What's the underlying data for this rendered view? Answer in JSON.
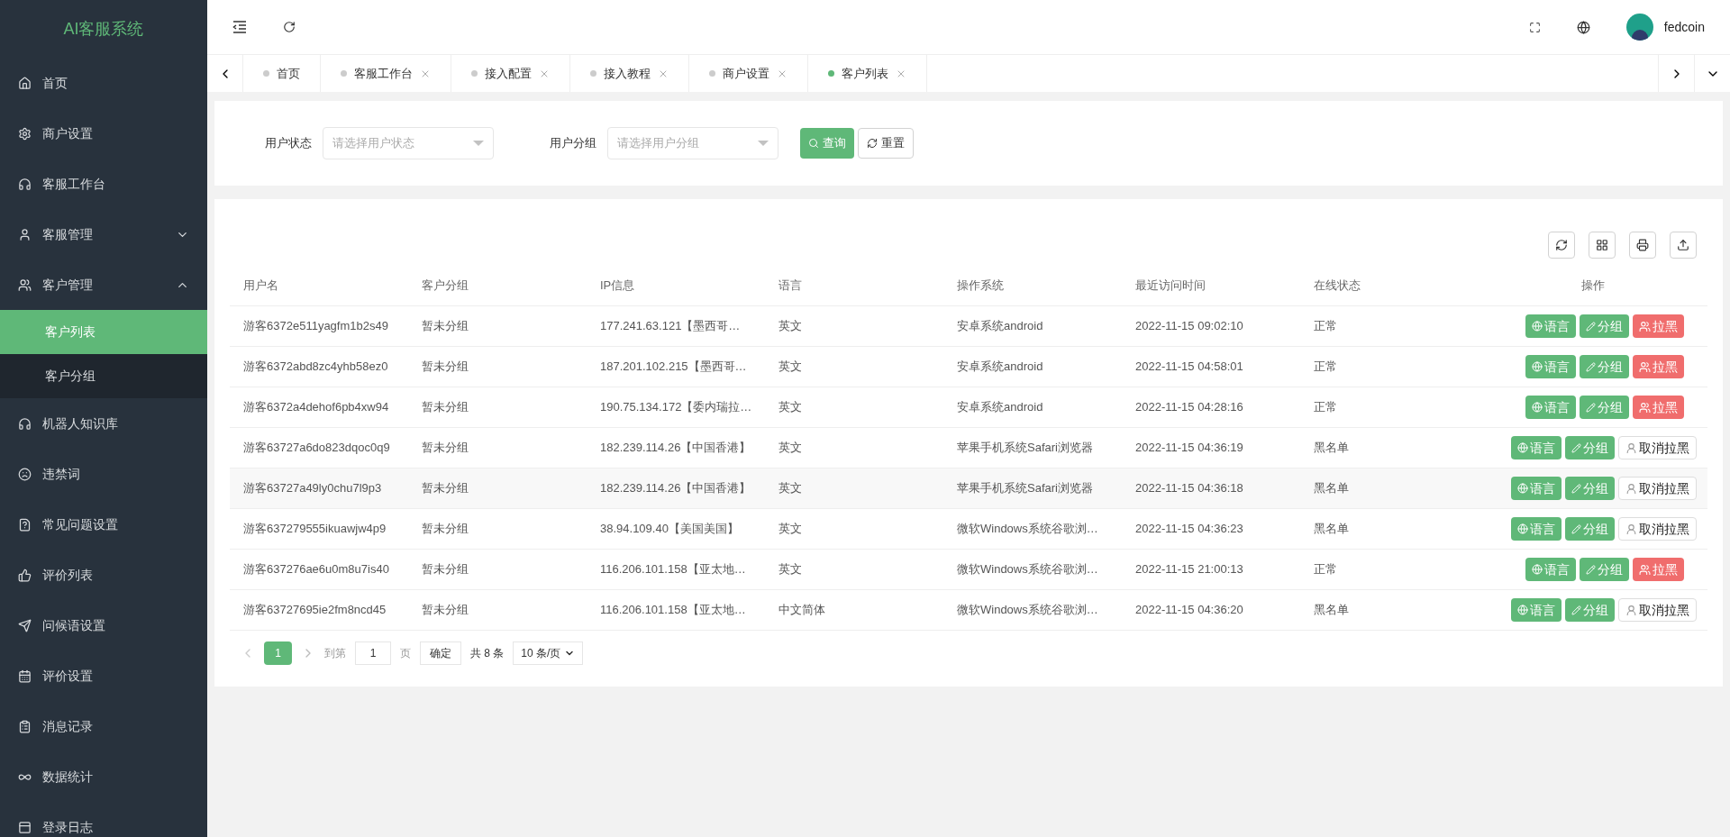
{
  "brand": "AI客服系统",
  "sidebar": {
    "items": [
      {
        "label": "首页",
        "selected": false
      },
      {
        "label": "商户设置",
        "selected": false
      },
      {
        "label": "客服工作台",
        "selected": false
      },
      {
        "label": "客服管理",
        "selected": false,
        "expanded": false
      },
      {
        "label": "客户管理",
        "selected": false,
        "expanded": true,
        "children": [
          {
            "label": "客户列表",
            "selected": true
          },
          {
            "label": "客户分组",
            "selected": false
          }
        ]
      },
      {
        "label": "机器人知识库",
        "selected": false
      },
      {
        "label": "违禁词",
        "selected": false
      },
      {
        "label": "常见问题设置",
        "selected": false
      },
      {
        "label": "评价列表",
        "selected": false
      },
      {
        "label": "问候语设置",
        "selected": false
      },
      {
        "label": "评价设置",
        "selected": false
      },
      {
        "label": "消息记录",
        "selected": false
      },
      {
        "label": "数据统计",
        "selected": false
      },
      {
        "label": "登录日志",
        "selected": false
      }
    ]
  },
  "header": {
    "username": "fedcoin"
  },
  "tabs": [
    {
      "label": "首页",
      "selected": false,
      "closable": false
    },
    {
      "label": "客服工作台",
      "selected": false,
      "closable": true
    },
    {
      "label": "接入配置",
      "selected": false,
      "closable": true
    },
    {
      "label": "接入教程",
      "selected": false,
      "closable": true
    },
    {
      "label": "商户设置",
      "selected": false,
      "closable": true
    },
    {
      "label": "客户列表",
      "selected": true,
      "closable": true
    }
  ],
  "filters": [
    {
      "label": "用户状态",
      "placeholder": "请选择用户状态"
    },
    {
      "label": "用户分组",
      "placeholder": "请选择用户分组"
    }
  ],
  "filter_buttons": {
    "search": "查询",
    "reset": "重置"
  },
  "table": {
    "columns": [
      "用户名",
      "客户分组",
      "IP信息",
      "语言",
      "操作系统",
      "最近访问时间",
      "在线状态",
      "操作"
    ],
    "rows": [
      {
        "username": "游客6372e511yagfm1b2s49",
        "group": "暂未分组",
        "ip": "177.241.63.121【墨西哥…",
        "language": "英文",
        "os": "安卓系统android",
        "last_visit": "2022-11-15 09:02:10",
        "status": "正常",
        "blacklisted": false,
        "actions": [
          "语言",
          "分组",
          "拉黑"
        ]
      },
      {
        "username": "游客6372abd8zc4yhb58ez0",
        "group": "暂未分组",
        "ip": "187.201.102.215【墨西哥…",
        "language": "英文",
        "os": "安卓系统android",
        "last_visit": "2022-11-15 04:58:01",
        "status": "正常",
        "blacklisted": false,
        "actions": [
          "语言",
          "分组",
          "拉黑"
        ]
      },
      {
        "username": "游客6372a4dehof6pb4xw94",
        "group": "暂未分组",
        "ip": "190.75.134.172【委内瑞拉…",
        "language": "英文",
        "os": "安卓系统android",
        "last_visit": "2022-11-15 04:28:16",
        "status": "正常",
        "blacklisted": false,
        "actions": [
          "语言",
          "分组",
          "拉黑"
        ]
      },
      {
        "username": "游客63727a6do823dqoc0q9",
        "group": "暂未分组",
        "ip": "182.239.114.26【中国香港】",
        "language": "英文",
        "os": "苹果手机系统Safari浏览器",
        "last_visit": "2022-11-15 04:36:19",
        "status": "黑名单",
        "blacklisted": true,
        "actions": [
          "语言",
          "分组",
          "取消拉黑"
        ]
      },
      {
        "username": "游客63727a49ly0chu7l9p3",
        "group": "暂未分组",
        "ip": "182.239.114.26【中国香港】",
        "language": "英文",
        "os": "苹果手机系统Safari浏览器",
        "last_visit": "2022-11-15 04:36:18",
        "status": "黑名单",
        "blacklisted": true,
        "actions": [
          "语言",
          "分组",
          "取消拉黑"
        ]
      },
      {
        "username": "游客637279555ikuawjw4p9",
        "group": "暂未分组",
        "ip": "38.94.109.40【美国美国】",
        "language": "英文",
        "os": "微软Windows系统谷歌浏…",
        "last_visit": "2022-11-15 04:36:23",
        "status": "黑名单",
        "blacklisted": true,
        "actions": [
          "语言",
          "分组",
          "取消拉黑"
        ]
      },
      {
        "username": "游客637276ae6u0m8u7is40",
        "group": "暂未分组",
        "ip": "116.206.101.158【亚太地…",
        "language": "英文",
        "os": "微软Windows系统谷歌浏…",
        "last_visit": "2022-11-15 21:00:13",
        "status": "正常",
        "blacklisted": false,
        "actions": [
          "语言",
          "分组",
          "拉黑"
        ]
      },
      {
        "username": "游客63727695ie2fm8ncd45",
        "group": "暂未分组",
        "ip": "116.206.101.158【亚太地…",
        "language": "中文简体",
        "os": "微软Windows系统谷歌浏…",
        "last_visit": "2022-11-15 04:36:20",
        "status": "黑名单",
        "blacklisted": true,
        "actions": [
          "语言",
          "分组",
          "取消拉黑"
        ]
      }
    ]
  },
  "pagination": {
    "pages": [
      {
        "label": "1",
        "selected": true
      }
    ],
    "goto_prefix": "到第",
    "goto_value": "1",
    "goto_suffix": "页",
    "confirm": "确定",
    "total": "共 8 条",
    "page_size": "10 条/页"
  }
}
